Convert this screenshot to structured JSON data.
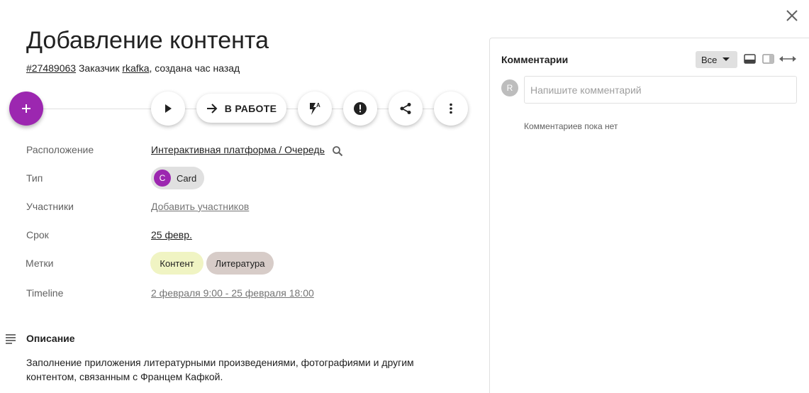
{
  "header": {
    "title": "Добавление контента",
    "task_id": "#27489063",
    "customer_prefix": "Заказчик",
    "customer": "rkafka",
    "created": ", создана час назад"
  },
  "actions": {
    "status_label": "В РАБОТЕ"
  },
  "properties": {
    "location_label": "Расположение",
    "location_value": "Интерактивная платформа / Очередь",
    "type_label": "Тип",
    "type_value": "Card",
    "type_avatar": "C",
    "participants_label": "Участники",
    "participants_value": "Добавить участников",
    "due_label": "Срок",
    "due_value": "25 февр.",
    "tags_label": "Метки",
    "tags": [
      {
        "label": "Контент",
        "color": "#f0f4c3"
      },
      {
        "label": "Литература",
        "color": "#d7ccc8"
      }
    ],
    "timeline_label": "Timeline",
    "timeline_value": "2 февраля 9:00 - 25 февраля 18:00"
  },
  "description": {
    "title": "Описание",
    "text": "Заполнение приложения литературными произведениями, фотографиями и другим контентом, связанным с Францем Кафкой."
  },
  "comments": {
    "title": "Комментарии",
    "filter": "Все",
    "user_initial": "R",
    "placeholder": "Напишите комментарий",
    "empty": "Комментариев пока нет"
  },
  "colors": {
    "accent": "#9c27b0"
  }
}
